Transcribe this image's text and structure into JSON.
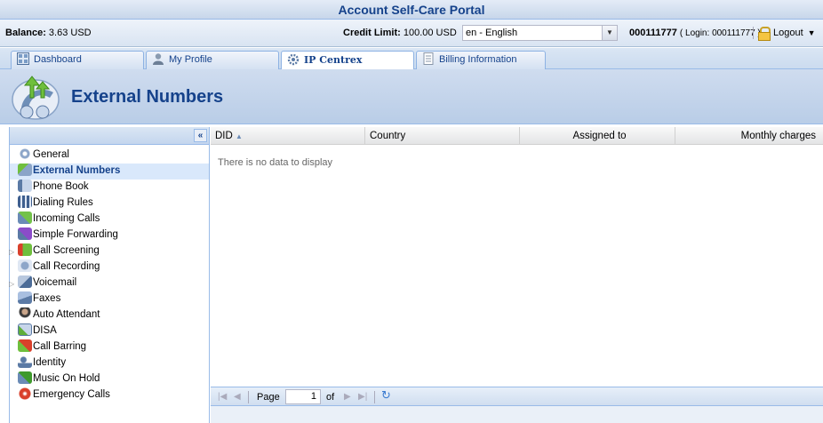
{
  "portal": {
    "title": "Account Self-Care Portal"
  },
  "info": {
    "balance_label": "Balance:",
    "balance_value": "3.63 USD",
    "credit_label": "Credit Limit:",
    "credit_value": "100.00 USD",
    "language": "en - English",
    "account_id": "000111777",
    "login_prefix": "( Login: ",
    "login_value": "000111777",
    "login_suffix": " )",
    "logout_label": "Logout"
  },
  "tabs": [
    {
      "label": "Dashboard"
    },
    {
      "label": "My Profile"
    },
    {
      "label": "IP Centrex",
      "active": true
    },
    {
      "label": "Billing Information"
    }
  ],
  "page": {
    "title": "External Numbers"
  },
  "sidebar": {
    "items": [
      {
        "label": "General",
        "icon": "gear-icon"
      },
      {
        "label": "External Numbers",
        "icon": "external-numbers-icon",
        "selected": true
      },
      {
        "label": "Phone Book",
        "icon": "phone-book-icon"
      },
      {
        "label": "Dialing Rules",
        "icon": "dialing-rules-icon"
      },
      {
        "label": "Incoming Calls",
        "icon": "incoming-calls-icon"
      },
      {
        "label": "Simple Forwarding",
        "icon": "forwarding-icon"
      },
      {
        "label": "Call Screening",
        "icon": "call-screening-icon",
        "expandable": true
      },
      {
        "label": "Call Recording",
        "icon": "call-recording-icon"
      },
      {
        "label": "Voicemail",
        "icon": "voicemail-icon",
        "expandable": true
      },
      {
        "label": "Faxes",
        "icon": "fax-icon"
      },
      {
        "label": "Auto Attendant",
        "icon": "auto-attendant-icon"
      },
      {
        "label": "DISA",
        "icon": "disa-icon"
      },
      {
        "label": "Call Barring",
        "icon": "call-barring-icon"
      },
      {
        "label": "Identity",
        "icon": "identity-icon"
      },
      {
        "label": "Music On Hold",
        "icon": "music-icon"
      },
      {
        "label": "Emergency Calls",
        "icon": "emergency-icon"
      }
    ]
  },
  "grid": {
    "columns": [
      "DID",
      "Country",
      "Assigned to",
      "Monthly charges"
    ],
    "empty_text": "There is no data to display",
    "pager": {
      "page_label": "Page",
      "page_value": "1",
      "of_label": "of"
    }
  },
  "colors": {
    "accent": "#15428b",
    "border": "#99bbe8"
  }
}
